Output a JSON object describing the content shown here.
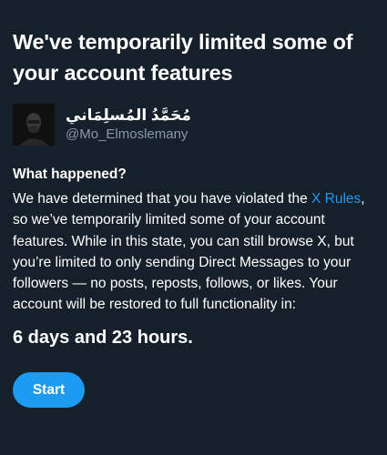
{
  "title": "We've temporarily limited some of your account features",
  "account": {
    "display_name": "مُحَمَّدُ المُسلِمَاني",
    "handle": "@Mo_Elmoslemany"
  },
  "section_heading": "What happened?",
  "body": {
    "line1_pre": "We have determined that you have violated the ",
    "line1_link": "X Rules",
    "line1_post": ",",
    "line2": "so we’ve temporarily limited some of your account",
    "line3": "features. While in this state, you can still browse X, but",
    "line4": "you’re limited to only sending Direct Messages to your",
    "line5": "followers — no posts, reposts, follows, or likes. Your",
    "line6": "account will be restored to full functionality in:"
  },
  "countdown": "6 days and 23 hours.",
  "start_button_label": "Start",
  "colors": {
    "background": "#15202b",
    "accent": "#1d9bf0",
    "secondary_text": "#8b98a5"
  }
}
